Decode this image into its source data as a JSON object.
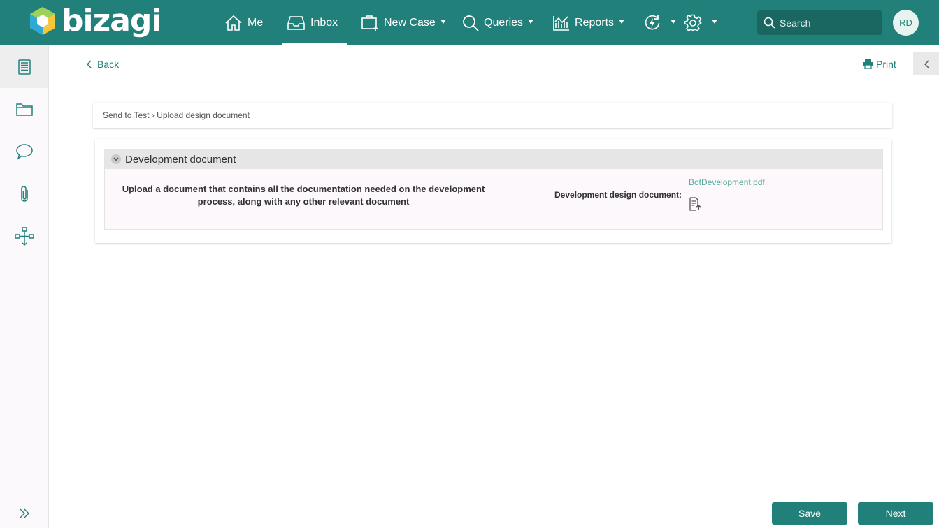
{
  "app": {
    "logo_text": "bizagi"
  },
  "nav": {
    "me": "Me",
    "inbox": "Inbox",
    "new_case": "New Case",
    "queries": "Queries",
    "reports": "Reports"
  },
  "search": {
    "placeholder": "Search"
  },
  "user": {
    "initials": "RD"
  },
  "toolbar": {
    "back": "Back",
    "print": "Print"
  },
  "breadcrumb": "Send to Test › Upload design document",
  "form": {
    "group_title": "Development document",
    "description": "Upload a document that contains all the documentation needed on the development process, along with any other relevant document",
    "field_label": "Development design document:",
    "file_name": "BotDevelopment.pdf"
  },
  "footer": {
    "save": "Save",
    "next": "Next"
  },
  "colors": {
    "primary": "#21817a",
    "link": "#5aa99a"
  },
  "icons": [
    "home-icon",
    "inbox-icon",
    "new-case-icon",
    "search-icon",
    "reports-icon",
    "activity-icon",
    "gear-icon",
    "form-icon",
    "folder-icon",
    "comment-icon",
    "paperclip-icon",
    "workflow-icon",
    "expand-icon",
    "back-chevron-icon",
    "print-icon",
    "collapse-chevron-icon",
    "upload-file-icon"
  ]
}
